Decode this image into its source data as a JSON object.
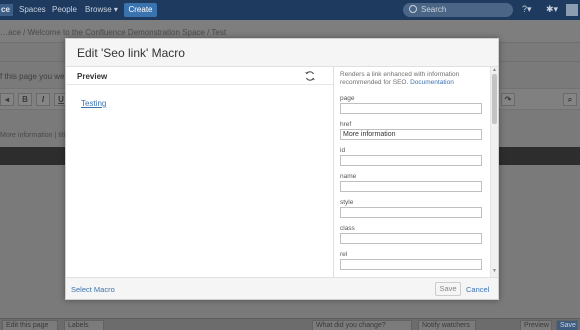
{
  "topnav": {
    "logo": "ce",
    "items": [
      "Spaces",
      "People",
      "Browse"
    ],
    "create_label": "Create",
    "search_placeholder": "Search"
  },
  "background": {
    "breadcrumb": "…ace  /  Welcome to the Confluence Demonstration Space  /  Test",
    "ask_text": "f this page you were…",
    "toolbar_buttons": [
      "B",
      "I",
      "U"
    ],
    "info_text": "More information | title",
    "bottom_left_1": "Edit this page",
    "bottom_left_2": "Labels",
    "bottom_mid": "What did you change?",
    "bottom_right_1": "Notify watchers",
    "bottom_right_2": "Preview",
    "bottom_right_3": "Save"
  },
  "dialog": {
    "title": "Edit 'Seo link' Macro",
    "preview_label": "Preview",
    "preview_link_text": "Testing",
    "description": "Renders a link enhanced with information recommended for SEO.",
    "doc_link": "Documentation",
    "fields": [
      {
        "label": "page",
        "value": ""
      },
      {
        "label": "href",
        "value": "More information"
      },
      {
        "label": "id",
        "value": ""
      },
      {
        "label": "name",
        "value": ""
      },
      {
        "label": "style",
        "value": ""
      },
      {
        "label": "class",
        "value": ""
      },
      {
        "label": "rel",
        "value": ""
      }
    ],
    "select_macro_label": "Select Macro",
    "save_label": "Save",
    "cancel_label": "Cancel"
  }
}
